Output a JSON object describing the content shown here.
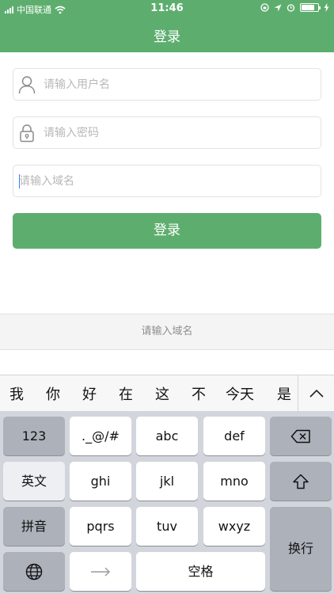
{
  "status_bar": {
    "carrier": "中国联通",
    "time": "11:46",
    "battery_level": 0.8
  },
  "nav": {
    "title": "登录"
  },
  "form": {
    "username_placeholder": "请输入用户名",
    "password_placeholder": "请输入密码",
    "domain_placeholder": "请输入域名",
    "login_label": "登录"
  },
  "accessory": {
    "hint": "请输入域名"
  },
  "candidates": {
    "items": [
      "我",
      "你",
      "好",
      "在",
      "这",
      "不",
      "今天",
      "是"
    ]
  },
  "keyboard": {
    "num_label": "123",
    "punct_label": "._@/#",
    "abc_label": "abc",
    "def_label": "def",
    "en_label": "英文",
    "ghi_label": "ghi",
    "jkl_label": "jkl",
    "mno_label": "mno",
    "pinyin_label": "拼音",
    "pqrs_label": "pqrs",
    "tuv_label": "tuv",
    "wxyz_label": "wxyz",
    "return_label": "换行",
    "space_label": "空格"
  },
  "colors": {
    "accent": "#5dae6e",
    "keyboard_bg": "#d2d5db",
    "function_key": "#acb1ba"
  },
  "icons": [
    "signal-icon",
    "wifi-icon",
    "rotation-lock-icon",
    "location-icon",
    "alarm-icon",
    "battery-icon",
    "charging-icon",
    "user-icon",
    "lock-icon",
    "chevron-up-icon",
    "backspace-icon",
    "shift-icon",
    "globe-icon",
    "arrow-right-icon"
  ]
}
